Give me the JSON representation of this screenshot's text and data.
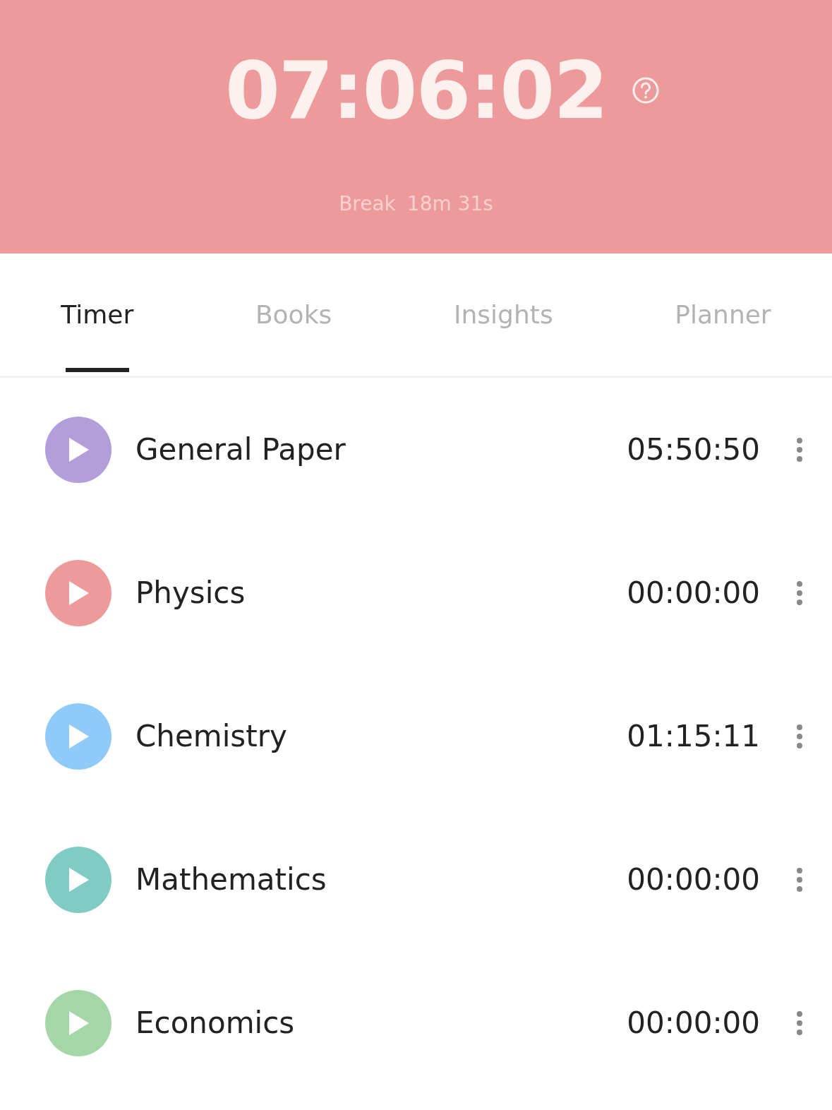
{
  "header": {
    "timer": "07:06:02",
    "break_label": "Break",
    "break_time": "18m 31s"
  },
  "tabs": [
    {
      "label": "Timer",
      "selected": true
    },
    {
      "label": "Books",
      "selected": false
    },
    {
      "label": "Insights",
      "selected": false
    },
    {
      "label": "Planner",
      "selected": false
    }
  ],
  "subjects": [
    {
      "name": "General Paper",
      "time": "05:50:50",
      "color": "#b39ddb"
    },
    {
      "name": "Physics",
      "time": "00:00:00",
      "color": "#ef9a9a"
    },
    {
      "name": "Chemistry",
      "time": "01:15:11",
      "color": "#90caf9"
    },
    {
      "name": "Mathematics",
      "time": "00:00:00",
      "color": "#80cbc4"
    },
    {
      "name": "Economics",
      "time": "00:00:00",
      "color": "#a5d6a7"
    }
  ]
}
